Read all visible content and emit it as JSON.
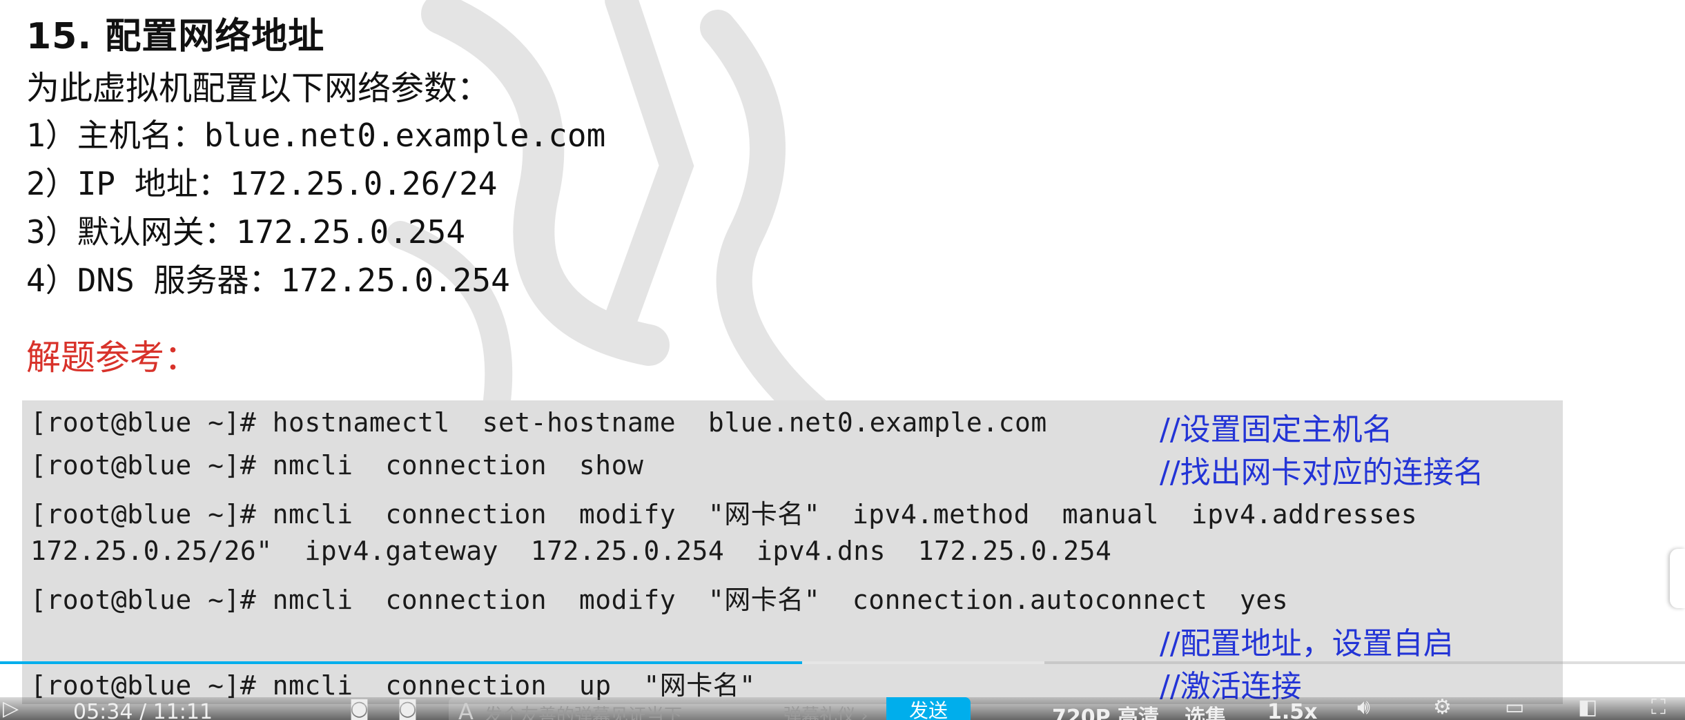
{
  "question": {
    "heading": "15. 配置网络地址",
    "intro": "为此虚拟机配置以下网络参数：",
    "items": [
      "1）主机名：blue.net0.example.com",
      "2）IP 地址：172.25.0.26/24",
      "3）默认网关：172.25.0.254",
      "4）DNS 服务器：172.25.0.254"
    ]
  },
  "answer": {
    "label": "解题参考：",
    "commands": [
      "[root@blue ~]# hostnamectl  set-hostname  blue.net0.example.com",
      "[root@blue ~]# nmcli  connection  show",
      "[root@blue ~]# nmcli  connection  modify  \"网卡名\"  ipv4.method  manual  ipv4.addresses",
      "172.25.0.25/26\"  ipv4.gateway  172.25.0.254  ipv4.dns  172.25.0.254",
      "[root@blue ~]# nmcli  connection  modify  \"网卡名\"  connection.autoconnect  yes",
      "[root@blue ~]# nmcli  connection  up  \"网卡名\""
    ],
    "comments": [
      "//设置固定主机名",
      "//找出网卡对应的连接名",
      "//配置地址，设置自启",
      "//激活连接"
    ]
  },
  "player": {
    "time": "05:34 / 11:11",
    "progress_fraction": 0.476,
    "buffered_fraction": 0.62,
    "danmaku_placeholder": "发个友善的弹幕见证当下",
    "danmaku_etiquette": "弹幕礼仪 ›",
    "send_label": "发送",
    "quality": "720P 高清",
    "episodes": "选集",
    "speed": "1.5x",
    "accent_color": "#00aeec"
  }
}
